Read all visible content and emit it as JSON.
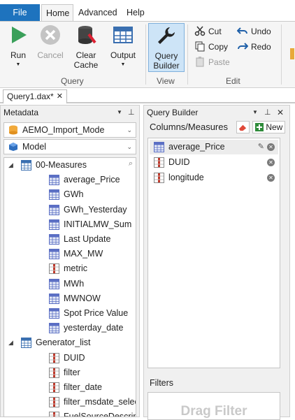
{
  "ribbon_tabs": {
    "file": "File",
    "home": "Home",
    "advanced": "Advanced",
    "help": "Help"
  },
  "ribbon": {
    "run": "Run",
    "cancel": "Cancel",
    "clear_cache_1": "Clear",
    "clear_cache_2": "Cache",
    "output": "Output",
    "query_builder_1": "Query",
    "query_builder_2": "Builder",
    "cut": "Cut",
    "copy": "Copy",
    "paste": "Paste",
    "undo": "Undo",
    "redo": "Redo",
    "group_query": "Query",
    "group_view": "View",
    "group_edit": "Edit"
  },
  "doc_tab": {
    "title": "Query1.dax*",
    "close": "✕"
  },
  "metadata": {
    "title": "Metadata",
    "model_dropdown": "AEMO_Import_Mode",
    "perspective_dropdown": "Model",
    "tree": [
      {
        "label": "00-Measures",
        "kind": "table",
        "level": 0
      },
      {
        "label": "average_Price",
        "kind": "measure",
        "level": 1
      },
      {
        "label": "GWh",
        "kind": "measure",
        "level": 1
      },
      {
        "label": "GWh_Yesterday",
        "kind": "measure",
        "level": 1
      },
      {
        "label": "INITIALMW_Sum",
        "kind": "measure",
        "level": 1
      },
      {
        "label": "Last Update",
        "kind": "measure",
        "level": 1
      },
      {
        "label": "MAX_MW",
        "kind": "measure",
        "level": 1
      },
      {
        "label": "metric",
        "kind": "column",
        "level": 1
      },
      {
        "label": "MWh",
        "kind": "measure",
        "level": 1
      },
      {
        "label": "MWNOW",
        "kind": "measure",
        "level": 1
      },
      {
        "label": "Spot Price Value",
        "kind": "measure",
        "level": 1
      },
      {
        "label": "yesterday_date",
        "kind": "measure",
        "level": 1
      },
      {
        "label": "Generator_list",
        "kind": "table",
        "level": 0
      },
      {
        "label": "DUID",
        "kind": "column",
        "level": 1
      },
      {
        "label": "filter",
        "kind": "column",
        "level": 1
      },
      {
        "label": "filter_date",
        "kind": "column",
        "level": 1
      },
      {
        "label": "filter_msdate_selection",
        "kind": "column",
        "level": 1
      },
      {
        "label": "FuelSourceDescriptor",
        "kind": "column",
        "level": 1
      }
    ]
  },
  "query_builder": {
    "title": "Query Builder",
    "columns_heading": "Columns/Measures",
    "new_button": "New",
    "columns": [
      {
        "label": "average_Price",
        "kind": "measure"
      },
      {
        "label": "DUID",
        "kind": "column"
      },
      {
        "label": "longitude",
        "kind": "column"
      }
    ],
    "filters_heading": "Filters",
    "filters_placeholder": "Drag Filter"
  },
  "colors": {
    "accent": "#1e73be",
    "selected": "#cde4f7",
    "measure": "#5b6fc4",
    "column": "#c0392b"
  }
}
